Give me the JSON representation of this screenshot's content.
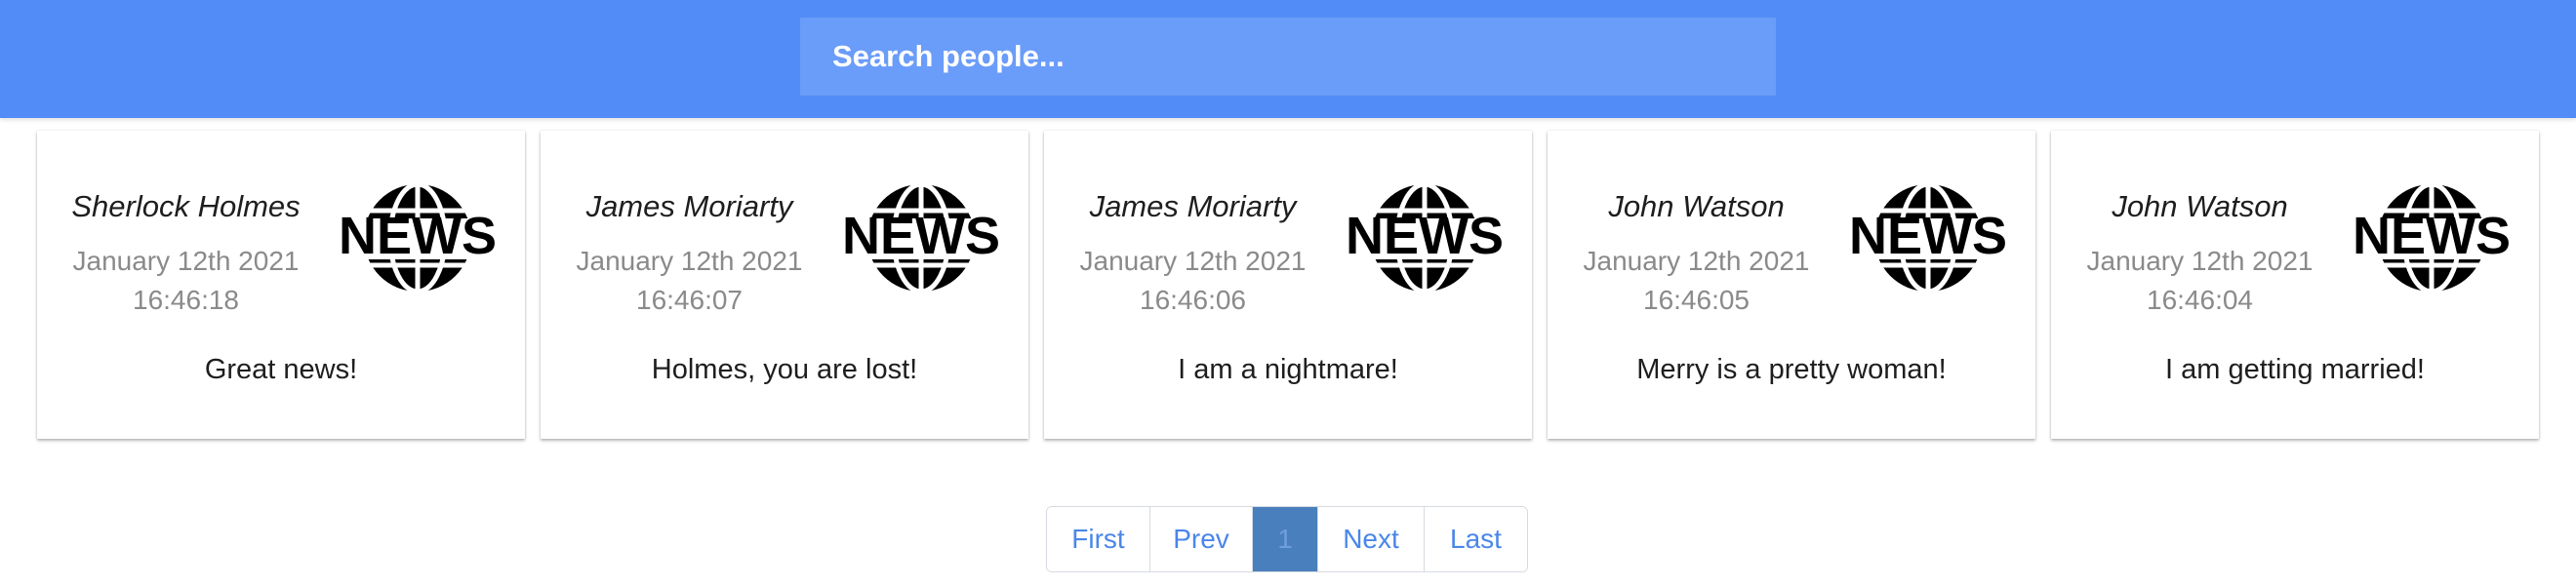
{
  "search": {
    "placeholder": "Search people..."
  },
  "cards": [
    {
      "author": "Sherlock Holmes",
      "date": "January 12th 2021",
      "time": "16:46:18",
      "message": "Great news!",
      "logo_text": "NEWS"
    },
    {
      "author": "James Moriarty",
      "date": "January 12th 2021",
      "time": "16:46:07",
      "message": "Holmes, you are lost!",
      "logo_text": "NEWS"
    },
    {
      "author": "James Moriarty",
      "date": "January 12th 2021",
      "time": "16:46:06",
      "message": "I am a nightmare!",
      "logo_text": "NEWS"
    },
    {
      "author": "John Watson",
      "date": "January 12th 2021",
      "time": "16:46:05",
      "message": "Merry is a pretty woman!",
      "logo_text": "NEWS"
    },
    {
      "author": "John Watson",
      "date": "January 12th 2021",
      "time": "16:46:04",
      "message": "I am getting married!",
      "logo_text": "NEWS"
    }
  ],
  "pagination": {
    "first": "First",
    "prev": "Prev",
    "current": "1",
    "next": "Next",
    "last": "Last"
  },
  "colors": {
    "topbar": "#528cf6",
    "search_bg": "#6a9cf9",
    "link": "#4a86e8",
    "active_page_bg": "#4a7fbd"
  },
  "icons": {
    "card_logo": "news-globe-icon"
  }
}
